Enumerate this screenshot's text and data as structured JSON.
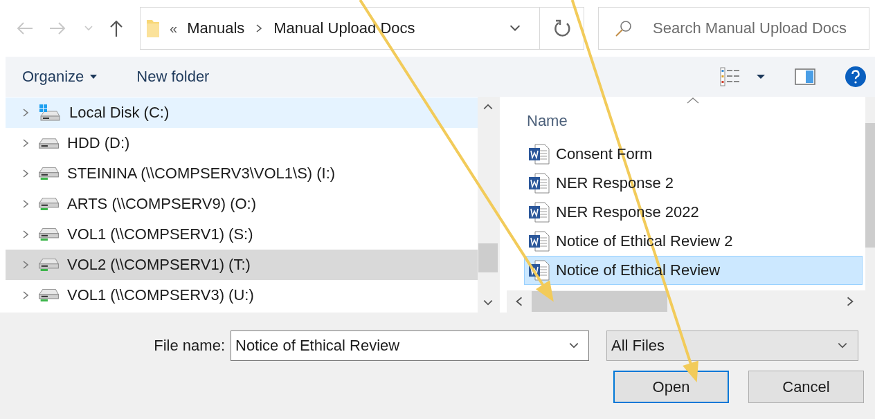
{
  "nav_buttons": [
    {
      "kind": "back",
      "disabled": true
    },
    {
      "kind": "forward",
      "disabled": true
    },
    {
      "kind": "recent",
      "disabled": true
    },
    {
      "kind": "up",
      "disabled": false
    }
  ],
  "address": {
    "overflow": "«",
    "path": [
      "Manuals",
      "Manual Upload Docs"
    ]
  },
  "search": {
    "placeholder": "Search Manual Upload Docs"
  },
  "toolbar": {
    "organize": "Organize",
    "new_folder": "New folder"
  },
  "tree": [
    {
      "label": "Local Disk (C:)",
      "kind": "system",
      "selected": true,
      "hovered": false
    },
    {
      "label": "HDD (D:)",
      "kind": "local",
      "selected": false,
      "hovered": false
    },
    {
      "label": "STEININA (\\\\COMPSERV3\\VOL1\\S) (I:)",
      "kind": "network",
      "selected": false,
      "hovered": false
    },
    {
      "label": "ARTS (\\\\COMPSERV9) (O:)",
      "kind": "network",
      "selected": false,
      "hovered": false
    },
    {
      "label": "VOL1 (\\\\COMPSERV1) (S:)",
      "kind": "network",
      "selected": false,
      "hovered": false
    },
    {
      "label": "VOL2 (\\\\COMPSERV1) (T:)",
      "kind": "network",
      "selected": false,
      "hovered": true
    },
    {
      "label": "VOL1 (\\\\COMPSERV3) (U:)",
      "kind": "network",
      "selected": false,
      "hovered": false
    }
  ],
  "files": {
    "column": "Name",
    "items": [
      {
        "name": "Consent Form",
        "selected": false
      },
      {
        "name": "NER Response 2",
        "selected": false
      },
      {
        "name": "NER Response 2022",
        "selected": false
      },
      {
        "name": "Notice of Ethical Review 2",
        "selected": false
      },
      {
        "name": "Notice of Ethical Review",
        "selected": true
      }
    ]
  },
  "file_name": {
    "label": "File name:",
    "value": "Notice of Ethical Review"
  },
  "file_type": {
    "value": "All Files"
  },
  "buttons": [
    {
      "label": "Open",
      "default": true
    },
    {
      "label": "Cancel",
      "default": false
    }
  ],
  "annotations": [
    {
      "kind": "arrow",
      "color": "#f2cb5a"
    },
    {
      "kind": "arrow",
      "color": "#f2cb5a"
    }
  ]
}
